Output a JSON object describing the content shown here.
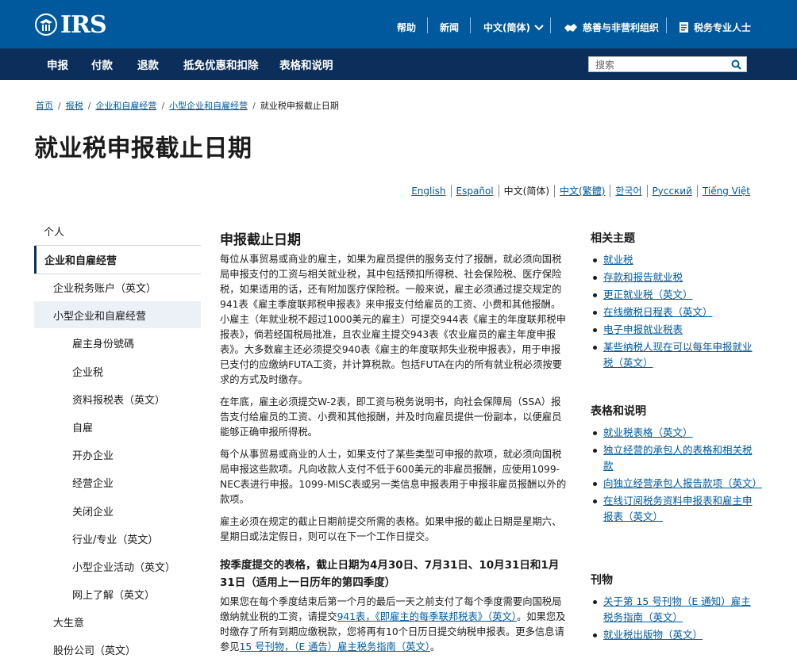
{
  "header": {
    "logo_text": "IRS",
    "utility": {
      "help": "帮助",
      "news": "新闻",
      "language": "中文(简体)",
      "charities": "慈善与非营利组织",
      "tax_pros": "税务专业人士"
    }
  },
  "nav": {
    "items": [
      "申报",
      "付款",
      "退款",
      "抵免优惠和扣除",
      "表格和说明"
    ],
    "search_placeholder": "搜索"
  },
  "breadcrumb": {
    "items": [
      "首页",
      "报税",
      "企业和自雇经营",
      "小型企业和自雇经营"
    ],
    "current": "就业税申报截止日期"
  },
  "page_title": "就业税申报截止日期",
  "languages": [
    "English",
    "Español",
    "中文(简体)",
    "中文(繁體)",
    "한국어",
    "Русский",
    "Tiếng Việt"
  ],
  "sidebar": {
    "items": [
      "个人",
      "企业和自雇经营",
      "企业税务账户（英文）",
      "小型企业和自雇经营",
      "雇主身份號碼",
      "企业税",
      "资料报税表（英文）",
      "自雇",
      "开办企业",
      "经营企业",
      "关闭企业",
      "行业/专业（英文）",
      "小型企业活动（英文）",
      "网上了解（英文）",
      "大生意",
      "股份公司（英文）"
    ]
  },
  "main": {
    "heading": "申报截止日期",
    "p1": "每位从事贸易或商业的雇主，如果为雇员提供的服务支付了报酬，就必须向国税局申报支付的工资与相关就业税，其中包括预扣所得税、社会保险税、医疗保险税，如果适用的话，还有附加医疗保险税。一般来说，雇主必须通过提交规定的941表《雇主季度联邦税申报表》来申报支付给雇员的工资、小费和其他报酬。小雇主（年就业税不超过1000美元的雇主）可提交944表《雇主的年度联邦税申报表》，倘若经国税局批准，且农业雇主提交943表《农业雇员的雇主年度申报表》。大多数雇主还必须提交940表《雇主的年度联邦失业税申报表》，用于申报已支付的应缴纳FUTA工资，并计算税款。包括FUTA在内的所有就业税必须按要求的方式及时缴存。",
    "p2": "在年底，雇主必须提交W-2表，即工资与税务说明书，向社会保障局（SSA）报告支付给雇员的工资、小费和其他报酬，并及时向雇员提供一份副本，以便雇员能够正确申报所得税。",
    "p3": "每个从事贸易或商业的人士，如果支付了某些类型可申报的款项，就必须向国税局申报这些款项。凡向收款人支付不低于600美元的非雇员报酬，应使用1099-NEC表进行申报。1099-MISC表或另一类信息申报表用于申报非雇员报酬以外的款项。",
    "p4": "雇主必须在规定的截止日期前提交所需的表格。如果申报的截止日期是星期六、星期日或法定假日，则可以在下一个工作日提交。",
    "subheading": "按季度提交的表格，截止日期为4月30日、7月31日、10月31日和1月31日（适用上一日历年的第四季度）",
    "p5_a": "如果您在每个季度结束后第一个月的最后一天之前支付了每个季度需要向国税局缴纳就业税的工资，请提交",
    "p5_link1": "941表，《即雇主的每季联邦税表》（英文）",
    "p5_b": "。如果您及时缴存了所有到期应缴税款，您将再有10个日历日提交纳税申报表。更多信息请参见",
    "p5_link2": "15 号刊物，（E 通告）雇主税务指南（英文）",
    "p5_c": "。"
  },
  "related": {
    "title": "相关主题",
    "links": [
      "就业税",
      "存款和报告就业税",
      "更正就业税（英文）",
      "在线缴税日程表（英文）",
      "电子申报就业税表",
      "某些纳税人现在可以每年申报就业税（英文）"
    ]
  },
  "forms": {
    "title": "表格和说明",
    "links": [
      "就业税表格（英文）",
      "独立经营的承包人的表格和相关税款",
      "向独立经营承包人报告款项（英文）",
      "在线订阅税务资料申报表和雇主申报表（英文）"
    ]
  },
  "pubs": {
    "title": "刊物",
    "links": [
      "关于第 15 号刊物（E 通知）雇主税务指南（英文）",
      "就业税出版物（英文）"
    ]
  }
}
